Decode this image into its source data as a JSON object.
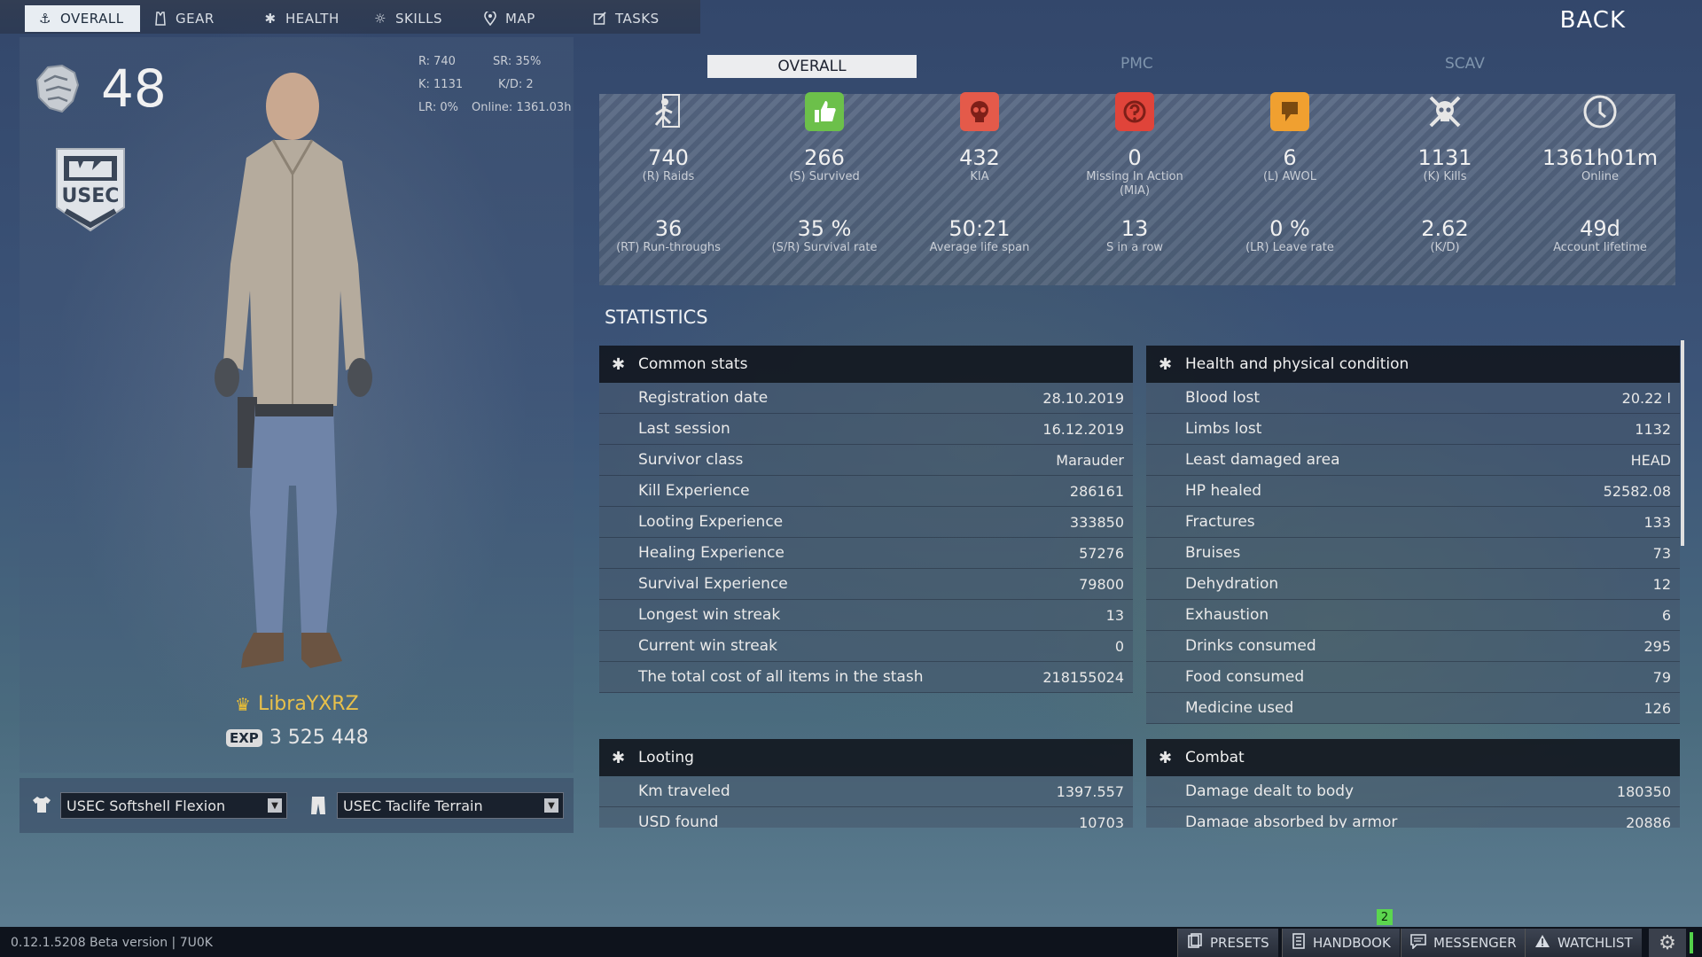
{
  "tabs": [
    {
      "label": "OVERALL",
      "icon": "anchor-icon"
    },
    {
      "label": "GEAR",
      "icon": "vest-icon"
    },
    {
      "label": "HEALTH",
      "icon": "medical-icon"
    },
    {
      "label": "SKILLS",
      "icon": "sun-icon"
    },
    {
      "label": "MAP",
      "icon": "map-pin-icon"
    },
    {
      "label": "TASKS",
      "icon": "tasks-icon"
    }
  ],
  "back_label": "BACK",
  "profile": {
    "level": "48",
    "mini_stats": {
      "raids": "R: 740",
      "sr": "SR: 35%",
      "kills": "K: 1131",
      "kd": "K/D: 2",
      "lr": "LR: 0%",
      "online": "Online: 1361.03h"
    },
    "nickname": "LibraYXRZ",
    "exp_badge": "EXP",
    "exp_value": "3 525 448",
    "faction_logo": "USEC"
  },
  "presets": {
    "top": "USEC Softshell Flexion",
    "bottom": "USEC Taclife Terrain"
  },
  "summary_tabs": [
    "OVERALL",
    "PMC",
    "SCAV"
  ],
  "summary_top": [
    {
      "value": "740",
      "label": "(R) Raids",
      "icon": "running-man-icon",
      "color": ""
    },
    {
      "value": "266",
      "label": "(S) Survived",
      "icon": "thumbs-up-icon",
      "color": "#6cc04a"
    },
    {
      "value": "432",
      "label": "KIA",
      "icon": "skull-icon",
      "color": "#e45a4a"
    },
    {
      "value": "0",
      "label": "Missing In Action (MIA)",
      "icon": "question-icon",
      "color": "#e0443a"
    },
    {
      "value": "6",
      "label": "(L) AWOL",
      "icon": "awol-icon",
      "color": "#f0a030"
    },
    {
      "value": "1131",
      "label": "(K) Kills",
      "icon": "skull-crossbones-icon",
      "color": ""
    },
    {
      "value": "1361h01m",
      "label": "Online",
      "icon": "clock-icon",
      "color": ""
    }
  ],
  "summary_bottom": [
    {
      "value": "36",
      "label": "(RT) Run-throughs"
    },
    {
      "value": "35 %",
      "label": "(S/R) Survival rate"
    },
    {
      "value": "50:21",
      "label": "Average life span"
    },
    {
      "value": "13",
      "label": "S in a row"
    },
    {
      "value": "0 %",
      "label": "(LR) Leave rate"
    },
    {
      "value": "2.62",
      "label": "(K/D)"
    },
    {
      "value": "49d",
      "label": "Account lifetime"
    }
  ],
  "statistics_title": "STATISTICS",
  "common_stats": {
    "title": "Common stats",
    "rows": [
      {
        "label": "Registration date",
        "value": "28.10.2019"
      },
      {
        "label": "Last session",
        "value": "16.12.2019"
      },
      {
        "label": "Survivor class",
        "value": "Marauder"
      },
      {
        "label": "Kill Experience",
        "value": "286161"
      },
      {
        "label": "Looting Experience",
        "value": "333850"
      },
      {
        "label": "Healing Experience",
        "value": "57276"
      },
      {
        "label": "Survival Experience",
        "value": "79800"
      },
      {
        "label": "Longest win streak",
        "value": "13"
      },
      {
        "label": "Current win streak",
        "value": "0"
      },
      {
        "label": "The total cost of all items in the stash",
        "value": "218155024"
      }
    ]
  },
  "health_stats": {
    "title": "Health and physical condition",
    "rows": [
      {
        "label": "Blood lost",
        "value": "20.22 l"
      },
      {
        "label": "Limbs lost",
        "value": "1132"
      },
      {
        "label": "Least damaged area",
        "value": "HEAD"
      },
      {
        "label": "HP healed",
        "value": "52582.08"
      },
      {
        "label": "Fractures",
        "value": "133"
      },
      {
        "label": "Bruises",
        "value": "73"
      },
      {
        "label": "Dehydration",
        "value": "12"
      },
      {
        "label": "Exhaustion",
        "value": "6"
      },
      {
        "label": "Drinks consumed",
        "value": "295"
      },
      {
        "label": "Food consumed",
        "value": "79"
      },
      {
        "label": "Medicine used",
        "value": "126"
      }
    ]
  },
  "looting_stats": {
    "title": "Looting",
    "rows": [
      {
        "label": "Km traveled",
        "value": "1397.557"
      },
      {
        "label": "USD found",
        "value": "10703"
      }
    ]
  },
  "combat_stats": {
    "title": "Combat",
    "rows": [
      {
        "label": "Damage dealt to body",
        "value": "180350"
      },
      {
        "label": "Damage absorbed by armor",
        "value": "20886"
      }
    ]
  },
  "bottom_bar": {
    "version": "0.12.1.5208 Beta version | 7U0K",
    "buttons": [
      "PRESETS",
      "HANDBOOK",
      "MESSENGER",
      "WATCHLIST"
    ],
    "notification_count": "2"
  }
}
